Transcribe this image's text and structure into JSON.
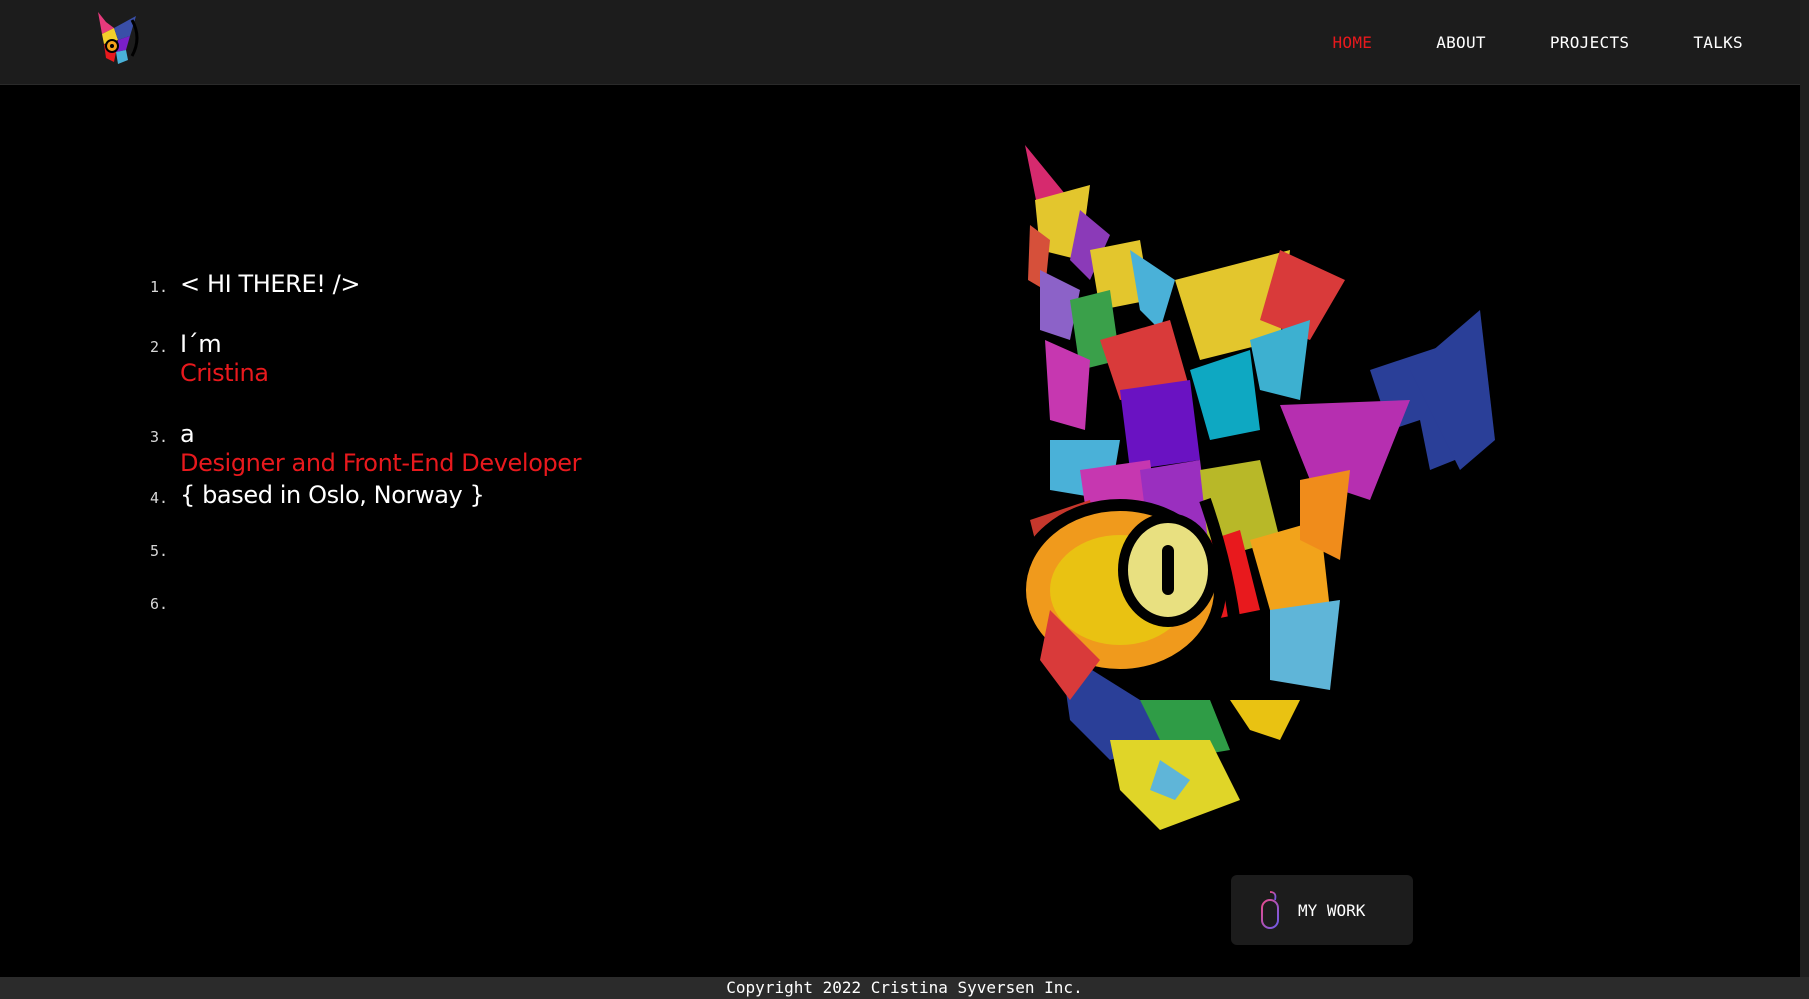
{
  "nav": {
    "logo_icon": "cat-logo-icon",
    "items": [
      {
        "label": "HOME",
        "active": true
      },
      {
        "label": "ABOUT",
        "active": false
      },
      {
        "label": "PROJECTS",
        "active": false
      },
      {
        "label": "TALKS",
        "active": false
      }
    ]
  },
  "intro": {
    "lines": [
      {
        "num": "1.",
        "text": "< HI THERE! />"
      },
      {
        "num": "2.",
        "text": "I´m",
        "highlight": "Cristina"
      },
      {
        "num": "3.",
        "text": "a",
        "highlight": "Designer and Front-End Developer"
      },
      {
        "num": "4.",
        "text": "{ based in Oslo, Norway }"
      },
      {
        "num": "5.",
        "text": ""
      },
      {
        "num": "6.",
        "text": ""
      }
    ]
  },
  "hero": {
    "image_icon": "geometric-cat-illustration"
  },
  "cta": {
    "label": "MY WORK",
    "icon": "mouse-icon"
  },
  "footer": {
    "copyright": "Copyright 2022 Cristina Syversen Inc."
  },
  "colors": {
    "accent": "#e8191d",
    "background": "#000000",
    "nav_bg": "#1c1c1c",
    "footer_bg": "#2b2b2b"
  }
}
